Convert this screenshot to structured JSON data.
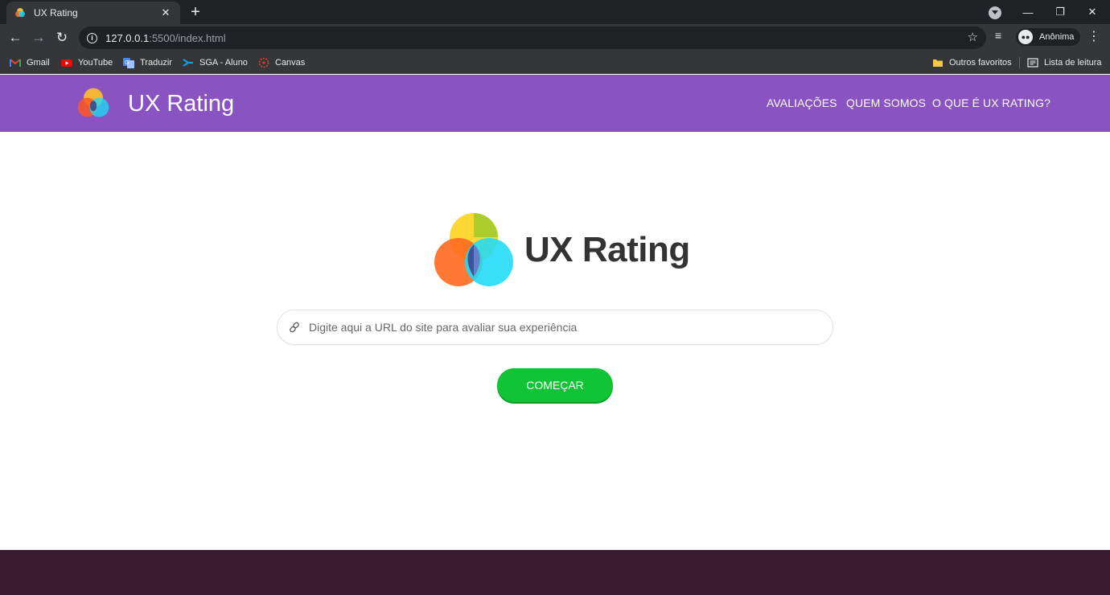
{
  "browser": {
    "tab_title": "UX Rating",
    "tab_close": "✕",
    "new_tab": "+",
    "url_host": "127.0.0.1",
    "url_path": ":5500/index.html",
    "profile_label": "Anônima",
    "window_controls": {
      "minimize": "—",
      "restore": "❐",
      "close": "✕"
    },
    "bookmarks": [
      {
        "label": "Gmail",
        "icon": "gmail-icon"
      },
      {
        "label": "YouTube",
        "icon": "youtube-icon"
      },
      {
        "label": "Traduzir",
        "icon": "translate-icon"
      },
      {
        "label": "SGA - Aluno",
        "icon": "sga-icon"
      },
      {
        "label": "Canvas",
        "icon": "canvas-icon"
      }
    ],
    "bookmarks_right": [
      {
        "label": "Outros favoritos",
        "icon": "folder-icon"
      },
      {
        "label": "Lista de leitura",
        "icon": "reading-list-icon"
      }
    ]
  },
  "header": {
    "title": "UX Rating",
    "nav": [
      "AVALIAÇÕES",
      "QUEM SOMOS",
      "O QUE É UX RATING?"
    ]
  },
  "hero": {
    "title": "UX Rating",
    "search_placeholder": "Digite aqui a URL do site para avaliar sua experiência",
    "cta_label": "COMEÇAR"
  },
  "colors": {
    "header_bg": "#8a53c2",
    "cta_bg": "#10c435",
    "footer_bg": "#3a1a2f"
  }
}
